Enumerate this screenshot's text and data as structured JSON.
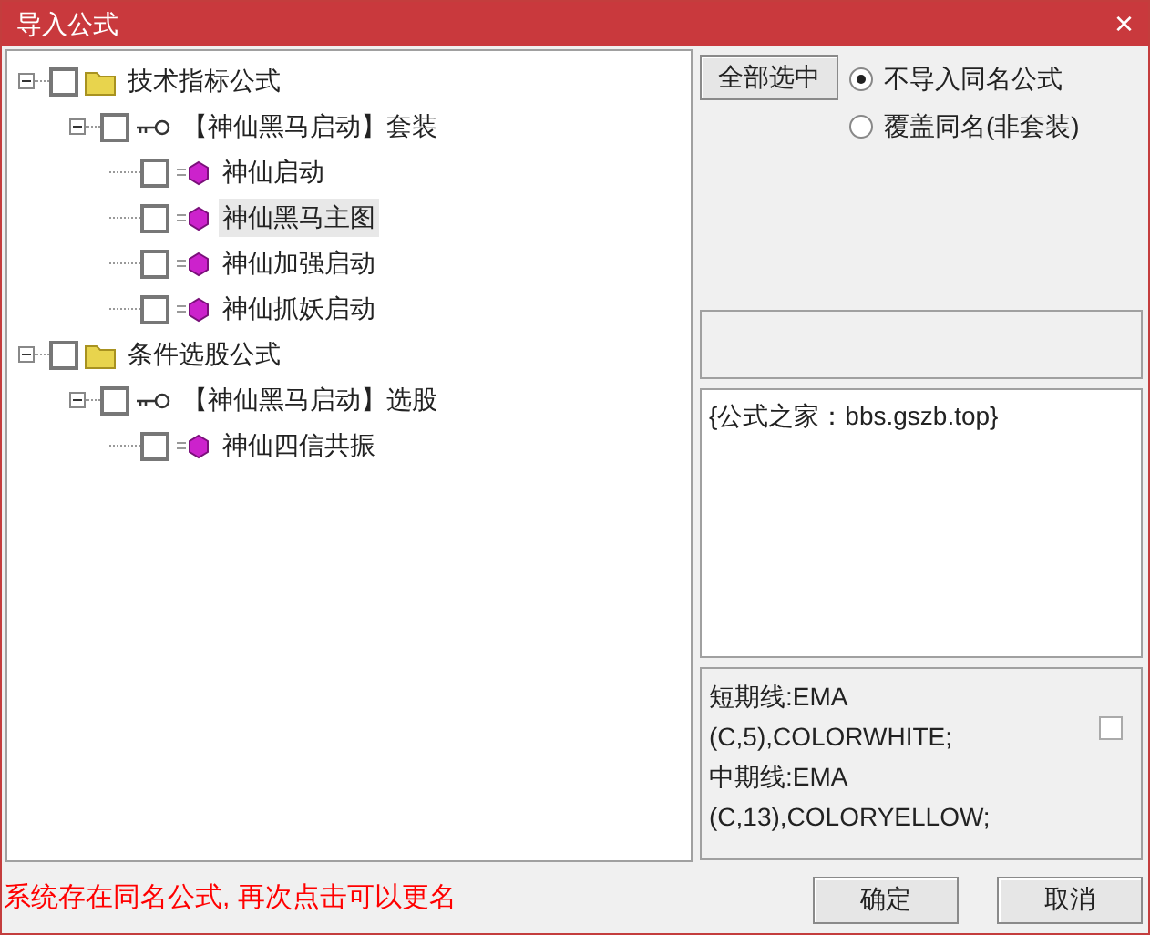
{
  "window": {
    "title": "导入公式",
    "close": "×"
  },
  "tree": [
    {
      "label": "技术指标公式",
      "kind": "folder",
      "checked": false,
      "expanded": true,
      "selected": false,
      "children": [
        {
          "label": "【神仙黑马启动】套装",
          "kind": "key",
          "checked": false,
          "expanded": true,
          "selected": false,
          "children": [
            {
              "label": "神仙启动",
              "kind": "formula",
              "checked": false,
              "selected": false
            },
            {
              "label": "神仙黑马主图",
              "kind": "formula",
              "checked": false,
              "selected": true
            },
            {
              "label": "神仙加强启动",
              "kind": "formula",
              "checked": false,
              "selected": false
            },
            {
              "label": "神仙抓妖启动",
              "kind": "formula",
              "checked": false,
              "selected": false
            }
          ]
        }
      ]
    },
    {
      "label": "条件选股公式",
      "kind": "folder",
      "checked": false,
      "expanded": true,
      "selected": false,
      "children": [
        {
          "label": "【神仙黑马启动】选股",
          "kind": "key",
          "checked": false,
          "expanded": true,
          "selected": false,
          "children": [
            {
              "label": "神仙四信共振",
              "kind": "formula",
              "checked": false,
              "selected": false
            }
          ]
        }
      ]
    }
  ],
  "select_all_button": "全部选中",
  "radios": [
    {
      "label": "不导入同名公式",
      "selected": true
    },
    {
      "label": "覆盖同名(非套装)",
      "selected": false
    }
  ],
  "info_text": "{公式之家：bbs.gszb.top}",
  "code_lines": [
    "短期线:EMA",
    "(C,5),COLORWHITE;",
    "中期线:EMA",
    "(C,13),COLORYELLOW;"
  ],
  "code_checkbox": {
    "checked": false
  },
  "status_message": "系统存在同名公式, 再次点击可以更名",
  "buttons": [
    "确定",
    "取消"
  ]
}
